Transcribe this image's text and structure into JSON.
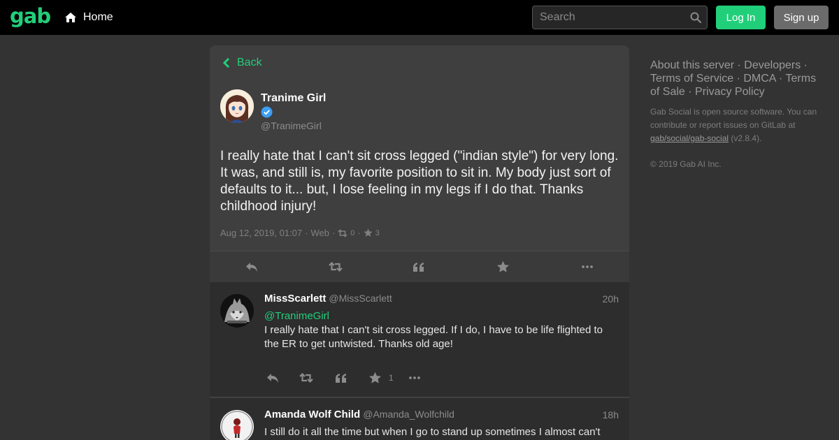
{
  "topbar": {
    "logo": "gab",
    "home_label": "Home",
    "search_placeholder": "Search",
    "login_label": "Log In",
    "signup_label": "Sign up"
  },
  "status": {
    "back_label": "Back",
    "author_name": "Tranime Girl",
    "author_handle": "@TranimeGirl",
    "text": "I really hate that I can't sit cross legged (\"indian style\") for very long. It was, and still is, my favorite position to sit in. My body just sort of defaults to it... but, I lose feeling in my legs if I do that. Thanks childhood injury!",
    "timestamp": "Aug 12, 2019, 01:07",
    "separator": "·",
    "application": "Web",
    "reblog_count": "0",
    "favourite_count": "3"
  },
  "replies": [
    {
      "name": "MissScarlett",
      "handle": "@MissScarlett",
      "time": "20h",
      "mention": "@TranimeGirl",
      "text": "I really hate that I can't sit cross legged.  If I do, I have to be life flighted to the ER to get untwisted.   Thanks old age!",
      "favourite_count": "1"
    },
    {
      "name": "Amanda Wolf Child",
      "handle": "@Amanda_Wolfchild",
      "time": "18h",
      "text": "I still do it all the time but when I go to stand up sometimes I almost can't"
    }
  ],
  "sidebar": {
    "links": [
      "About this server",
      "Developers",
      "Terms of Service",
      "DMCA",
      "Terms of Sale",
      "Privacy Policy"
    ],
    "separator": " · ",
    "info_prefix": "Gab Social is open source software. You can contribute or report issues on GitLab at ",
    "repo": "gab/social/gab-social",
    "version": " (v2.8.4).",
    "copyright": "© 2019 Gab AI Inc."
  },
  "colors": {
    "accent": "#21cf7a",
    "background": "#333333",
    "topbar": "#000000",
    "card": "#3f3f3f",
    "reply_card": "#2d2d2d"
  },
  "icons": [
    "home-icon",
    "search-icon",
    "chevron-left-icon",
    "verified-icon",
    "retweet-icon",
    "star-icon",
    "reply-icon",
    "quote-icon",
    "more-icon"
  ]
}
